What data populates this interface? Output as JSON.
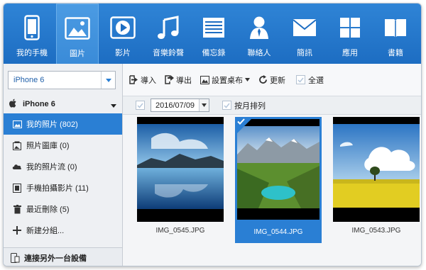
{
  "nav": [
    {
      "label": "我的手機",
      "icon": "phone-icon",
      "active": false
    },
    {
      "label": "圖片",
      "icon": "picture-icon",
      "active": true
    },
    {
      "label": "影片",
      "icon": "video-icon",
      "active": false
    },
    {
      "label": "音樂鈴聲",
      "icon": "music-icon",
      "active": false
    },
    {
      "label": "備忘錄",
      "icon": "notes-icon",
      "active": false
    },
    {
      "label": "聯絡人",
      "icon": "contacts-icon",
      "active": false
    },
    {
      "label": "簡訊",
      "icon": "mail-icon",
      "active": false
    },
    {
      "label": "應用",
      "icon": "apps-icon",
      "active": false
    },
    {
      "label": "書籍",
      "icon": "book-icon",
      "active": false
    }
  ],
  "sidebar": {
    "device_select": "iPhone 6",
    "device_name": "iPhone 6",
    "items": [
      {
        "label": "我的照片 (802)",
        "icon": "photo-icon",
        "active": true
      },
      {
        "label": "照片圖庫 (0)",
        "icon": "library-icon",
        "active": false
      },
      {
        "label": "我的照片流 (0)",
        "icon": "photostream-icon",
        "active": false
      },
      {
        "label": "手機拍攝影片 (11)",
        "icon": "film-icon",
        "active": false
      },
      {
        "label": "最近刪除 (5)",
        "icon": "trash-icon",
        "active": false
      },
      {
        "label": "新建分組...",
        "icon": "plus-icon",
        "active": false
      }
    ],
    "connect_label": "連接另外一台設備"
  },
  "toolbar": {
    "import_label": "導入",
    "export_label": "導出",
    "wallpaper_label": "設置桌布",
    "refresh_label": "更新",
    "select_all_label": "全選"
  },
  "filter": {
    "date": "2016/07/09",
    "sort_label": "按月排列"
  },
  "photos": [
    {
      "filename": "IMG_0545.JPG",
      "selected": false
    },
    {
      "filename": "IMG_0544.JPG",
      "selected": true
    },
    {
      "filename": "IMG_0543.JPG",
      "selected": false
    }
  ],
  "colors": {
    "nav_bg": "#1d6dc2",
    "accent": "#2a7fd4"
  }
}
